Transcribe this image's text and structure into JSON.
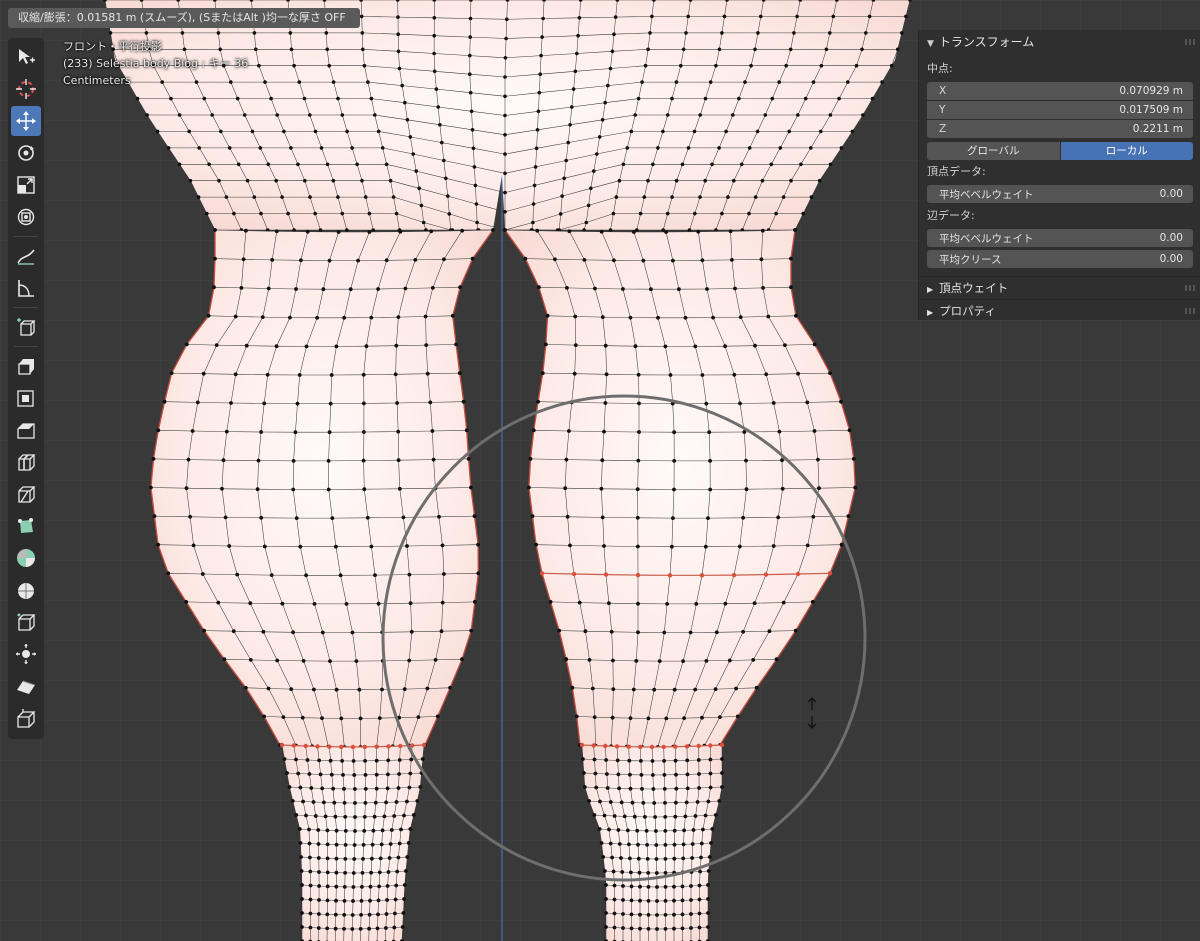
{
  "status_bar": {
    "text": "収縮/膨張：0.01581 m (スムーズ), (SまたはAlt )均一な厚さ OFF"
  },
  "viewport_info": {
    "view": "フロント・平行投影",
    "object": "(233) Selestia body Blog : キー 36",
    "units": "Centimeters"
  },
  "toolbar": {
    "tools": [
      {
        "icon": "select-cursor-icon",
        "active": false
      },
      {
        "icon": "cursor-3d-icon",
        "active": false
      },
      {
        "icon": "move-icon",
        "active": true
      },
      {
        "icon": "rotate-icon",
        "active": false
      },
      {
        "icon": "scale-icon",
        "active": false
      },
      {
        "icon": "transform-icon",
        "active": false
      },
      {
        "icon": "annotate-icon",
        "active": false
      },
      {
        "icon": "measure-icon",
        "active": false
      },
      {
        "icon": "add-cube-icon",
        "active": false
      },
      {
        "icon": "extrude-region-icon",
        "active": false
      },
      {
        "icon": "inset-faces-icon",
        "active": false
      },
      {
        "icon": "bevel-icon",
        "active": false
      },
      {
        "icon": "loop-cut-icon",
        "active": false
      },
      {
        "icon": "knife-icon",
        "active": false
      },
      {
        "icon": "poly-build-icon",
        "active": false
      },
      {
        "icon": "spin-icon",
        "active": false
      },
      {
        "icon": "smooth-icon",
        "active": false
      },
      {
        "icon": "edge-slide-icon",
        "active": false
      },
      {
        "icon": "shrink-fatten-icon",
        "active": false
      },
      {
        "icon": "shear-icon",
        "active": false
      },
      {
        "icon": "rip-region-icon",
        "active": false
      }
    ]
  },
  "npanel": {
    "transform_header": "トランスフォーム",
    "median_label": "中点:",
    "coords": [
      {
        "axis": "X",
        "value": "0.070929 m"
      },
      {
        "axis": "Y",
        "value": "0.017509 m"
      },
      {
        "axis": "Z",
        "value": "0.2211 m"
      }
    ],
    "global_label": "グローバル",
    "local_label": "ローカル",
    "vertex_data_label": "頂点データ:",
    "vertex_bevel": {
      "label": "平均ベベルウェイト",
      "value": "0.00"
    },
    "edge_data_label": "辺データ:",
    "edge_bevel": {
      "label": "平均ベベルウェイト",
      "value": "0.00"
    },
    "edge_crease": {
      "label": "平均クリース",
      "value": "0.00"
    },
    "vertex_weights_header": "頂点ウェイト",
    "properties_header": "プロパティ"
  },
  "colors": {
    "background": "#393939",
    "skin": "#fde8e4",
    "active_tool": "#4d78b8",
    "selected_edge": "#d44a3a",
    "axis_line": "#4a76c4"
  }
}
